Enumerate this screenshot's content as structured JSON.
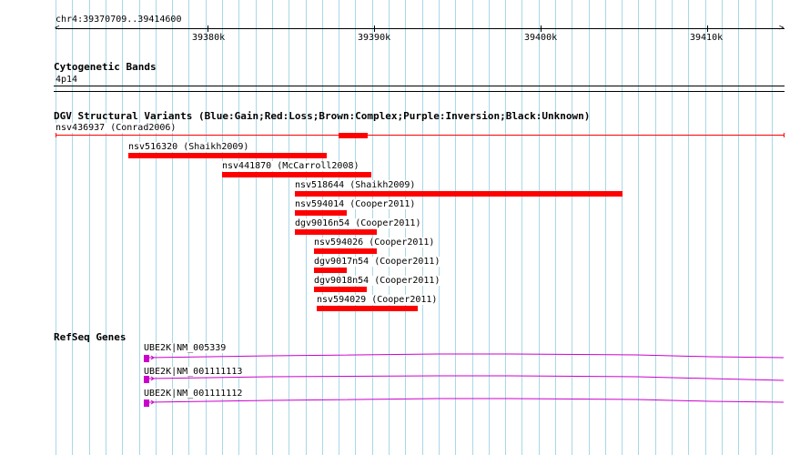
{
  "ruler": {
    "location": "chr4:39370709..39414600",
    "ticks": [
      "39380k",
      "39390k",
      "39400k",
      "39410k"
    ]
  },
  "cytoband": {
    "title": "Cytogenetic Bands",
    "band": "4p14"
  },
  "dgv": {
    "title": "DGV Structural Variants (Blue:Gain;Red:Loss;Brown:Complex;Purple:Inversion;Black:Unknown)",
    "color": "#ff0000",
    "features": [
      {
        "name": "nsv436937 (Conrad2006)"
      },
      {
        "name": "nsv516320 (Shaikh2009)"
      },
      {
        "name": "nsv441870 (McCarroll2008)"
      },
      {
        "name": "nsv518644 (Shaikh2009)"
      },
      {
        "name": "nsv594014 (Cooper2011)"
      },
      {
        "name": "dgv9016n54 (Cooper2011)"
      },
      {
        "name": "nsv594026 (Cooper2011)"
      },
      {
        "name": "dgv9017n54 (Cooper2011)"
      },
      {
        "name": "dgv9018n54 (Cooper2011)"
      },
      {
        "name": "nsv594029 (Cooper2011)"
      }
    ]
  },
  "refseq": {
    "title": "RefSeq Genes",
    "color": "#cc00cc",
    "genes": [
      {
        "name": "UBE2K|NM_005339"
      },
      {
        "name": "UBE2K|NM_001111113"
      },
      {
        "name": "UBE2K|NM_001111112"
      }
    ]
  },
  "colors": {
    "grid": "#a8d8e8",
    "loss": "#ff0000",
    "gene": "#cc00cc"
  }
}
